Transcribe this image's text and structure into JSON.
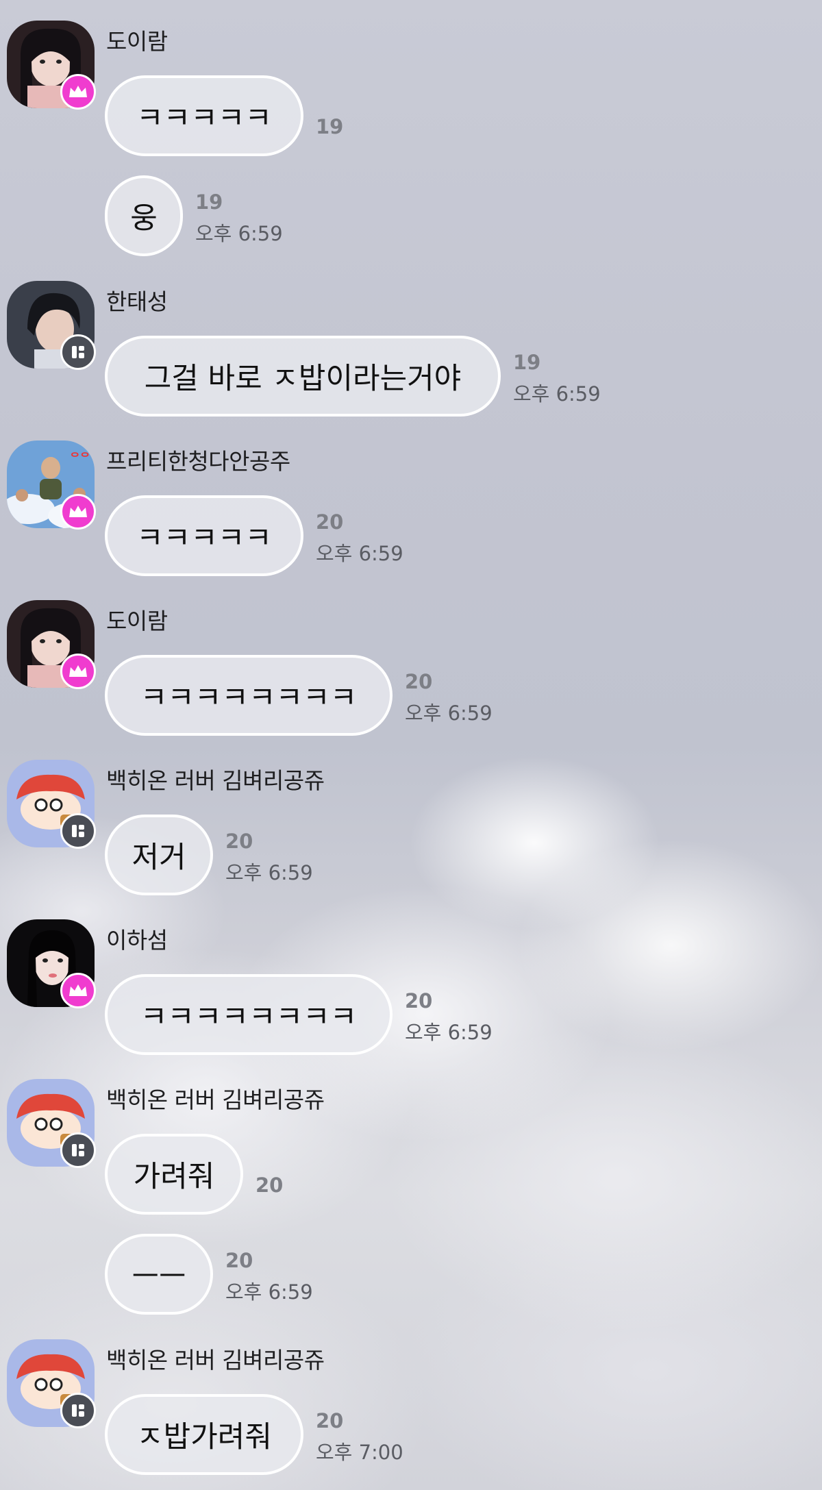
{
  "colors": {
    "crown_badge": "#f03ccf",
    "tile_badge": "#4a4d55",
    "bubble_border": "#ffffff",
    "unread_count": "#7d7f86",
    "timestamp": "#5a5c63"
  },
  "messages": [
    {
      "sender": "도이람",
      "avatar": "portrait-woman-dark-hair",
      "badge_icon": "crown-icon",
      "bubbles": [
        {
          "text": "ㅋㅋㅋㅋㅋ",
          "count": "19",
          "time": ""
        },
        {
          "text": "웅",
          "count": "19",
          "time": "오후 6:59"
        }
      ]
    },
    {
      "sender": "한태성",
      "avatar": "portrait-man-dark-hair",
      "badge_icon": "tile-icon",
      "bubbles": [
        {
          "text": "그걸 바로 ㅈ밥이라는거야",
          "count": "19",
          "time": "오후 6:59"
        }
      ]
    },
    {
      "sender": "프리티한청다안공주",
      "avatar": "sky-photo",
      "badge_icon": "crown-icon",
      "bubbles": [
        {
          "text": "ㅋㅋㅋㅋㅋ",
          "count": "20",
          "time": "오후 6:59"
        }
      ]
    },
    {
      "sender": "도이람",
      "avatar": "portrait-woman-dark-hair",
      "badge_icon": "crown-icon",
      "bubbles": [
        {
          "text": "ㅋㅋㅋㅋㅋㅋㅋㅋ",
          "count": "20",
          "time": "오후 6:59"
        }
      ]
    },
    {
      "sender": "백히온 러버 김벼리공쥬",
      "avatar": "cartoon-girl",
      "badge_icon": "tile-icon",
      "bubbles": [
        {
          "text": "저거",
          "count": "20",
          "time": "오후 6:59"
        }
      ]
    },
    {
      "sender": "이하섬",
      "avatar": "portrait-woman-black-hair",
      "badge_icon": "crown-icon",
      "bubbles": [
        {
          "text": "ㅋㅋㅋㅋㅋㅋㅋㅋ",
          "count": "20",
          "time": "오후 6:59"
        }
      ]
    },
    {
      "sender": "백히온 러버 김벼리공쥬",
      "avatar": "cartoon-girl",
      "badge_icon": "tile-icon",
      "bubbles": [
        {
          "text": "가려줘",
          "count": "20",
          "time": ""
        },
        {
          "text": "ㅡㅡ",
          "count": "20",
          "time": "오후 6:59"
        }
      ]
    },
    {
      "sender": "백히온 러버 김벼리공쥬",
      "avatar": "cartoon-girl",
      "badge_icon": "tile-icon",
      "bubbles": [
        {
          "text": "ㅈ밥가려줘",
          "count": "20",
          "time": "오후 7:00"
        }
      ]
    }
  ]
}
